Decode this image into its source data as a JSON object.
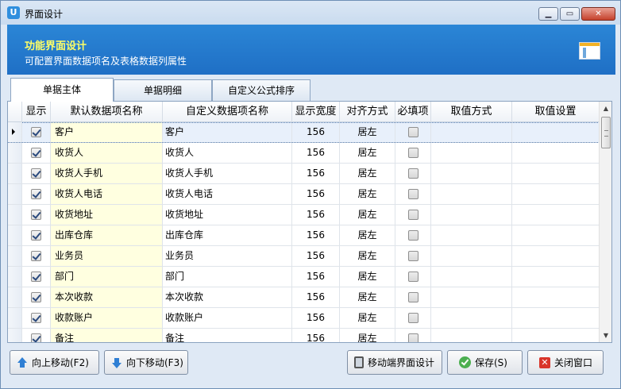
{
  "window": {
    "title": "界面设计",
    "app_icon": "app-icon",
    "controls": [
      "minimize-icon",
      "maximize-icon",
      "close-icon"
    ],
    "control_glyphs": {
      "minimize": "▁",
      "maximize": "▭",
      "close": "✕"
    }
  },
  "header": {
    "title": "功能界面设计",
    "subtitle": "可配置界面数据项名及表格数据列属性",
    "icon": "layout-design-icon",
    "title_color": "#ffff66",
    "background": "#2b86d6"
  },
  "tabs": [
    {
      "label": "单据主体",
      "active": true
    },
    {
      "label": "单据明细",
      "active": false
    },
    {
      "label": "自定义公式排序",
      "active": false
    }
  ],
  "grid": {
    "columns": [
      "显示",
      "默认数据项名称",
      "自定义数据项名称",
      "显示宽度",
      "对齐方式",
      "必填项",
      "取值方式",
      "取值设置"
    ],
    "rows": [
      {
        "show": true,
        "default_name": "客户",
        "custom_name": "客户",
        "width": "156",
        "align": "居左",
        "required": false,
        "value_mode": "",
        "value_setting": "",
        "selected": true
      },
      {
        "show": true,
        "default_name": "收货人",
        "custom_name": "收货人",
        "width": "156",
        "align": "居左",
        "required": false,
        "value_mode": "",
        "value_setting": ""
      },
      {
        "show": true,
        "default_name": "收货人手机",
        "custom_name": "收货人手机",
        "width": "156",
        "align": "居左",
        "required": false,
        "value_mode": "",
        "value_setting": ""
      },
      {
        "show": true,
        "default_name": "收货人电话",
        "custom_name": "收货人电话",
        "width": "156",
        "align": "居左",
        "required": false,
        "value_mode": "",
        "value_setting": ""
      },
      {
        "show": true,
        "default_name": "收货地址",
        "custom_name": "收货地址",
        "width": "156",
        "align": "居左",
        "required": false,
        "value_mode": "",
        "value_setting": ""
      },
      {
        "show": true,
        "default_name": "出库仓库",
        "custom_name": "出库仓库",
        "width": "156",
        "align": "居左",
        "required": false,
        "value_mode": "",
        "value_setting": ""
      },
      {
        "show": true,
        "default_name": "业务员",
        "custom_name": "业务员",
        "width": "156",
        "align": "居左",
        "required": false,
        "value_mode": "",
        "value_setting": ""
      },
      {
        "show": true,
        "default_name": "部门",
        "custom_name": "部门",
        "width": "156",
        "align": "居左",
        "required": false,
        "value_mode": "",
        "value_setting": ""
      },
      {
        "show": true,
        "default_name": "本次收款",
        "custom_name": "本次收款",
        "width": "156",
        "align": "居左",
        "required": false,
        "value_mode": "",
        "value_setting": ""
      },
      {
        "show": true,
        "default_name": "收款账户",
        "custom_name": "收款账户",
        "width": "156",
        "align": "居左",
        "required": false,
        "value_mode": "",
        "value_setting": ""
      },
      {
        "show": true,
        "default_name": "备注",
        "custom_name": "备注",
        "width": "156",
        "align": "居左",
        "required": false,
        "value_mode": "",
        "value_setting": ""
      }
    ]
  },
  "scrollbar": {
    "up_glyph": "▲",
    "down_glyph": "▼"
  },
  "buttons": {
    "move_up": {
      "label": "向上移动(F2)",
      "icon": "arrow-up-icon"
    },
    "move_down": {
      "label": "向下移动(F3)",
      "icon": "arrow-down-icon"
    },
    "mobile_design": {
      "label": "移动端界面设计",
      "icon": "mobile-icon"
    },
    "save": {
      "label": "保存(S)",
      "icon": "check-icon"
    },
    "close": {
      "label": "关闭窗口",
      "icon": "close-window-icon",
      "glyph": "✕"
    }
  },
  "colors": {
    "default_name_cell": "#ffffe0",
    "selected_row": "#e8f0fb",
    "window_border": "#6e8fb5"
  }
}
